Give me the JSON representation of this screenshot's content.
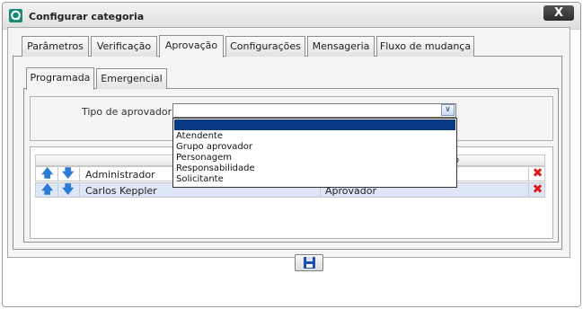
{
  "window": {
    "title": "Configurar categoria",
    "close_label": "X"
  },
  "tabs": [
    {
      "label": "Parâmetros"
    },
    {
      "label": "Verificação"
    },
    {
      "label": "Aprovação",
      "active": true
    },
    {
      "label": "Configurações"
    },
    {
      "label": "Mensageria"
    },
    {
      "label": "Fluxo de mudança"
    }
  ],
  "subtabs": [
    {
      "label": "Programada",
      "active": true
    },
    {
      "label": "Emergencial"
    }
  ],
  "form": {
    "approver_type_label": "Tipo de aprovador :",
    "approver_type_value": ""
  },
  "dropdown": {
    "options": [
      "",
      "Atendente",
      "Grupo aprovador",
      "Personagem",
      "Responsabilidade",
      "Solicitante"
    ],
    "selected_index": 0
  },
  "grid": {
    "header_visible_fragment": "o",
    "rows": [
      {
        "name": "Administrador",
        "type": ""
      },
      {
        "name": "Carlos Keppler",
        "type": "Aprovador"
      }
    ]
  },
  "icons": {
    "app": "app-logo-icon",
    "move_up": "arrow-up-icon",
    "move_down": "arrow-down-icon",
    "delete": "delete-x-icon",
    "save": "floppy-disk-icon"
  },
  "colors": {
    "accent": "#0a3a87",
    "selected_row": "#dde6f6",
    "delete": "#e01a1a",
    "arrow": "#2a7bd6",
    "close_button": "#2b2b2b"
  }
}
